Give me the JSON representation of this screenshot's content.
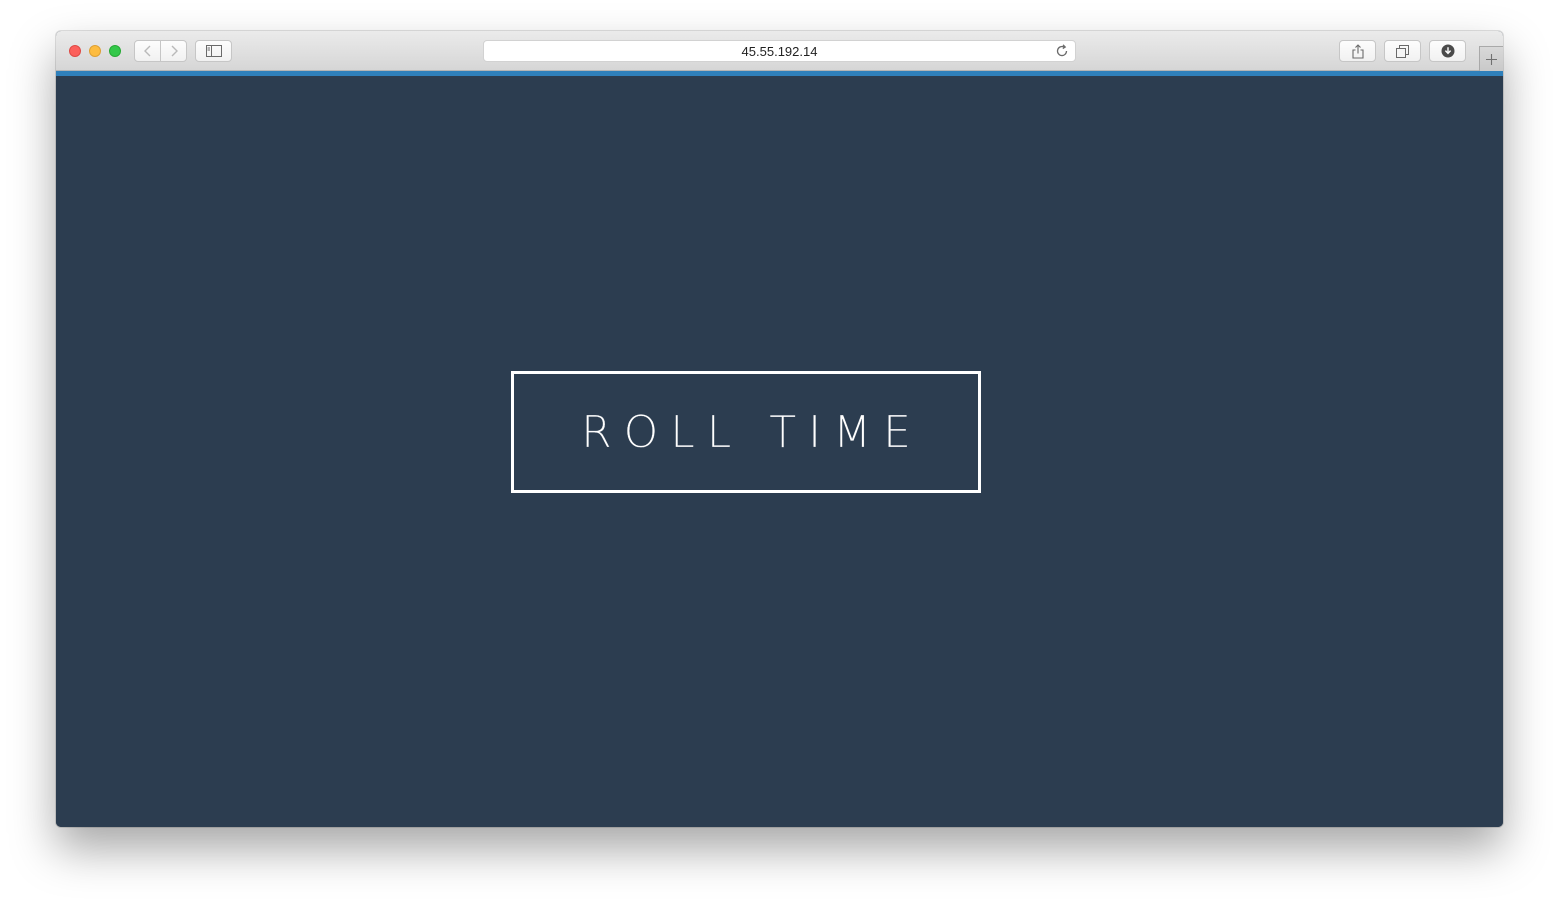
{
  "browser": {
    "address": "45.55.192.14",
    "icons": {
      "close": "close-circle",
      "minimize": "minimize-circle",
      "maximize": "maximize-circle",
      "back": "chevron-left-icon",
      "forward": "chevron-right-icon",
      "sidebar": "sidebar-icon",
      "reload": "reload-icon",
      "share": "share-icon",
      "tabs": "tabs-icon",
      "download": "download-icon",
      "new_tab": "plus-icon"
    }
  },
  "page": {
    "logo_text": "ROLL TIME"
  },
  "colors": {
    "background": "#2c3d50",
    "accent_bar": "#2f80bb",
    "logo": "#ffffff"
  }
}
